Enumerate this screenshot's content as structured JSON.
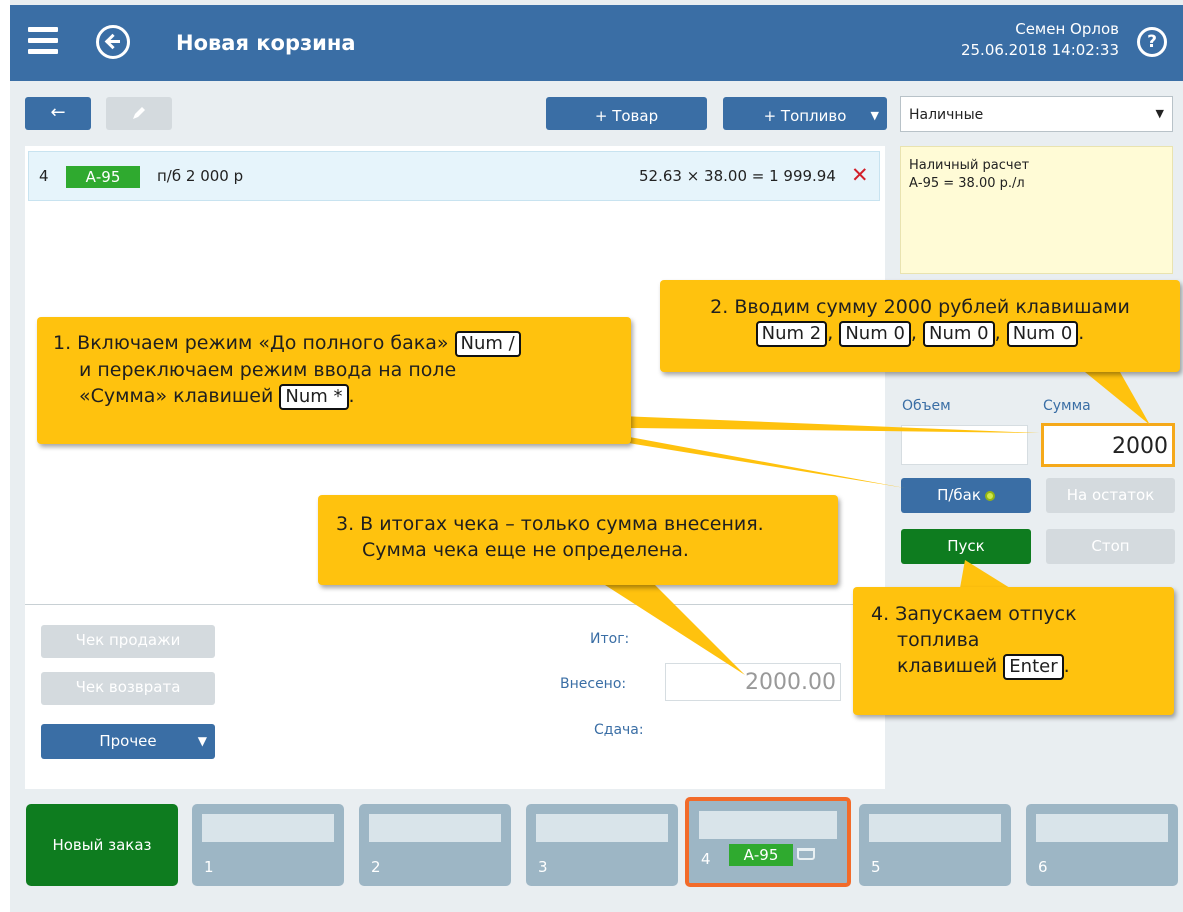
{
  "header": {
    "title": "Новая корзина",
    "user_name": "Семен Орлов",
    "datetime": "25.06.2018 14:02:33",
    "help_label": "?"
  },
  "toolbar": {
    "back_label": "←",
    "add_goods_label": "+ Товар",
    "add_fuel_label": "+ Топливо",
    "caret": "▼"
  },
  "payment": {
    "selected": "Наличные",
    "info_line1": "Наличный расчет",
    "info_line2": "А-95 = 38.00 р./л"
  },
  "cart": {
    "items": [
      {
        "index": "4",
        "fuel": "А-95",
        "desc": "п/б 2 000 р",
        "calc": "52.63 × 38.00 = 1 999.94",
        "remove": "✕"
      }
    ]
  },
  "actions": {
    "sale_receipt": "Чек продажи",
    "return_receipt": "Чек возврата",
    "other": "Прочее"
  },
  "totals": {
    "total_label": "Итог:",
    "paid_label": "Внесено:",
    "paid_value": "2000.00",
    "change_label": "Сдача:"
  },
  "dispense": {
    "volume_label": "Объем",
    "sum_label": "Сумма",
    "sum_value": "2000",
    "full_tank": "П/бак",
    "to_remainder": "На остаток",
    "start": "Пуск",
    "stop": "Стоп"
  },
  "tabs": {
    "new_order": "Новый заказ",
    "items": [
      "1",
      "2",
      "3",
      "4",
      "5",
      "6"
    ],
    "active_badge": "А-95"
  },
  "callouts": {
    "c1": {
      "line1": "1. Включаем режим «До полного бака»",
      "key1": "Num /",
      "line2": "и переключаем режим ввода на поле",
      "line3": "«Сумма» клавишей",
      "key2": "Num *",
      "end": "."
    },
    "c2": {
      "line1": "2. Вводим сумму 2000 рублей клавишами",
      "keys": [
        "Num 2",
        "Num 0",
        "Num 0",
        "Num 0"
      ],
      "sep": ",",
      "end": "."
    },
    "c3": {
      "line1": "3. В итогах чека – только сумма внесения.",
      "line2": "Сумма чека еще не определена."
    },
    "c4": {
      "line1": "4. Запускаем отпуск",
      "line2": "топлива",
      "line3": "клавишей",
      "key": "Enter",
      "end": "."
    }
  },
  "colors": {
    "header_bg": "#3a6ea5",
    "callout_bg": "#ffc20e",
    "accent_orange": "#f26b2a",
    "fuel_badge": "#2faa2f",
    "start_green": "#0e7c1f"
  }
}
